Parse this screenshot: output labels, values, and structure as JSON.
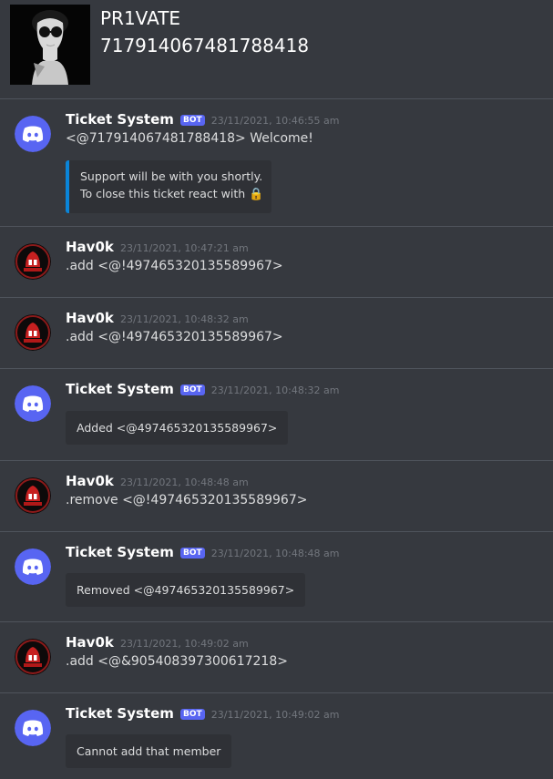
{
  "header": {
    "title": "PR1VATE",
    "subtitle": "717914067481788418",
    "icon": "private-avatar-icon"
  },
  "messages": [
    {
      "username": "Ticket System",
      "bot_badge": "BOT",
      "timestamp": "23/11/2021, 10:46:55 am",
      "content": "<@717914067481788418> Welcome!",
      "embed": {
        "line1": "Support will be with you shortly.",
        "line2": "To close this ticket react with",
        "emoji": "🔒"
      },
      "avatar": "discord-logo-icon"
    },
    {
      "username": "Hav0k",
      "timestamp": "23/11/2021, 10:47:21 am",
      "content": ".add <@!497465320135589967>",
      "avatar": "hooded-figure-icon"
    },
    {
      "username": "Hav0k",
      "timestamp": "23/11/2021, 10:48:32 am",
      "content": ".add <@!497465320135589967>",
      "avatar": "hooded-figure-icon"
    },
    {
      "username": "Ticket System",
      "bot_badge": "BOT",
      "timestamp": "23/11/2021, 10:48:32 am",
      "embed_text": "Added <@497465320135589967>",
      "avatar": "discord-logo-icon"
    },
    {
      "username": "Hav0k",
      "timestamp": "23/11/2021, 10:48:48 am",
      "content": ".remove <@!497465320135589967>",
      "avatar": "hooded-figure-icon"
    },
    {
      "username": "Ticket System",
      "bot_badge": "BOT",
      "timestamp": "23/11/2021, 10:48:48 am",
      "embed_text": "Removed <@497465320135589967>",
      "avatar": "discord-logo-icon"
    },
    {
      "username": "Hav0k",
      "timestamp": "23/11/2021, 10:49:02 am",
      "content": ".add <@&905408397300617218>",
      "avatar": "hooded-figure-icon"
    },
    {
      "username": "Ticket System",
      "bot_badge": "BOT",
      "timestamp": "23/11/2021, 10:49:02 am",
      "embed_text": "Cannot add that member",
      "avatar": "discord-logo-icon"
    }
  ],
  "colors": {
    "background": "#36393f",
    "embed_bg": "#2f3136",
    "accent": "#5865f2",
    "embed_border": "#0a85d9",
    "divider": "#4f545c",
    "timestamp": "#72767d"
  }
}
